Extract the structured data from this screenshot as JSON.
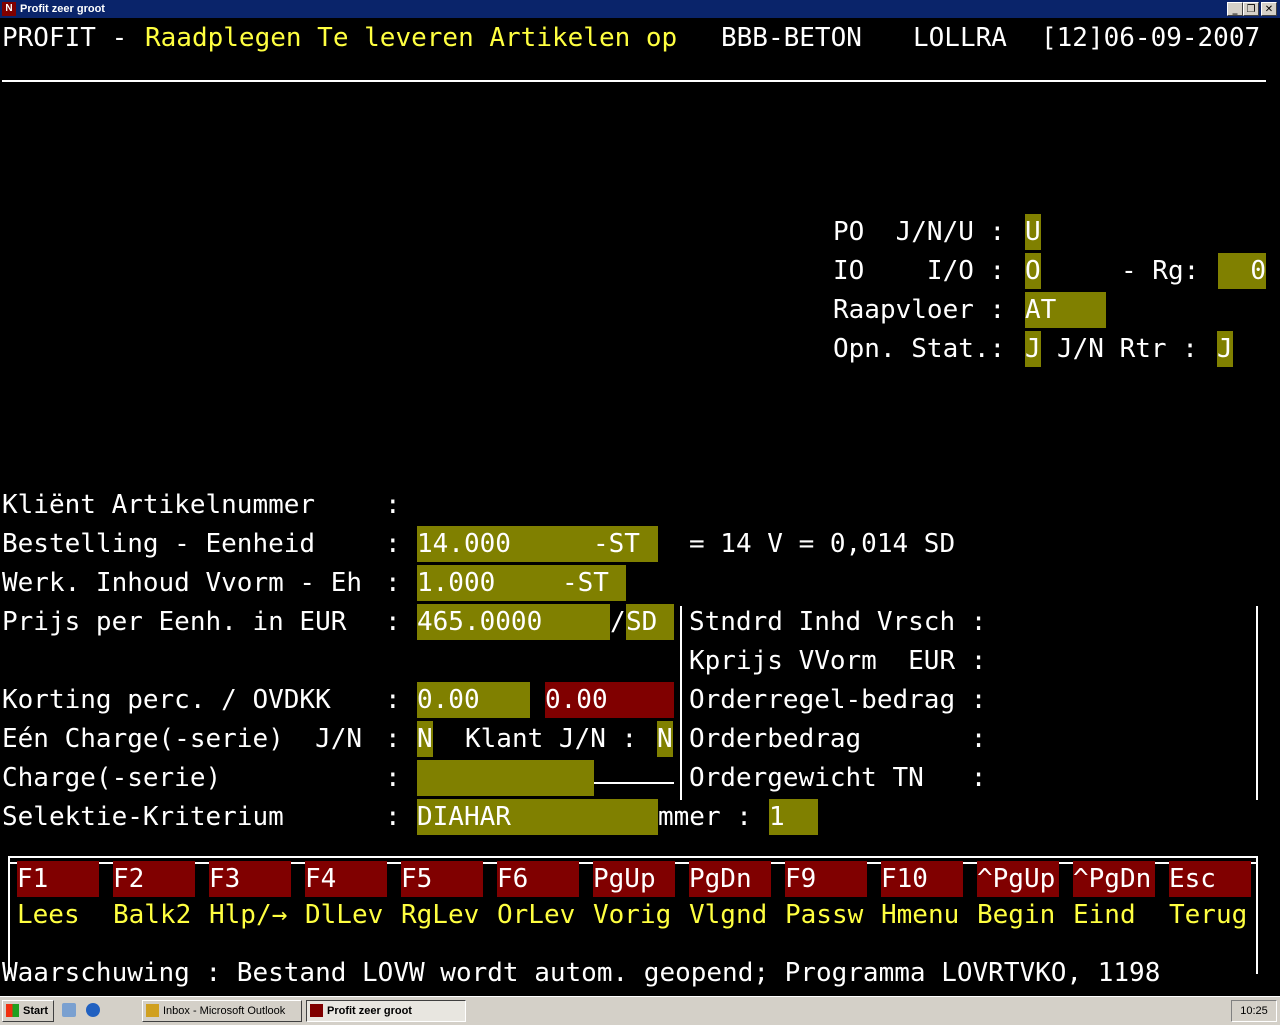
{
  "window": {
    "title": "Profit zeer groot",
    "icon_letter": "N",
    "min_glyph": "_",
    "max_glyph": "❐",
    "close_glyph": "✕"
  },
  "header": {
    "app": "PROFIT -",
    "title": "Raadplegen Te leveren Artikelen op",
    "company": "BBB-BETON",
    "user": "LOLLRA",
    "date": "[12]06-09-2007"
  },
  "options": {
    "po_label": "PO  J/N/U :",
    "po_value": "U",
    "io_label": "IO    I/O :",
    "io_value": "O",
    "rg_label": "- Rg:",
    "rg_value": "0",
    "raapvloer_label": "Raapvloer :",
    "raapvloer_value": "AT",
    "opn_label": "Opn. Stat.:",
    "opn_value": "J",
    "rtr_label": "J/N Rtr :",
    "rtr_value": "J"
  },
  "form": {
    "klient_label": "Kliënt Artikelnummer",
    "bestelling_label": "Bestelling - Eenheid",
    "bestelling_value": "14.000",
    "bestelling_unit": "-ST",
    "bestelling_info": "= 14 V = 0,014 SD",
    "werk_label": "Werk. Inhoud Vvorm - Eh",
    "werk_value": "1.000",
    "werk_unit": "-ST",
    "prijs_label": "Prijs per Eenh. in EUR",
    "prijs_value": "465.0000",
    "prijs_sep": "/",
    "prijs_unit": "SD",
    "korting_label": "Korting perc. / OVDKK",
    "korting_value": "0.00",
    "ovdkk_value": "0.00",
    "charge_label": "Eén Charge(-serie)  J/N",
    "charge_value": "N",
    "klant_label": "Klant J/N :",
    "klant_value": "N",
    "charge_serie_label": "Charge(-serie)",
    "selectie_label": "Selektie-Kriterium",
    "selectie_value": "DIAHAR",
    "nummer_label": "mmer :",
    "nummer_value": "1",
    "colon": ":"
  },
  "right_panel": {
    "stndrd": "Stndrd Inhd Vrsch :",
    "kprijs": "Kprijs VVorm  EUR :",
    "orderregel": "Orderregel-bedrag :",
    "orderbedrag": "Orderbedrag       :",
    "ordergewicht": "Ordergewicht TN   :"
  },
  "function_keys": [
    {
      "key": "F1",
      "label": "Lees"
    },
    {
      "key": "F2",
      "label": "Balk2"
    },
    {
      "key": "F3",
      "label": "Hlp/→"
    },
    {
      "key": "F4",
      "label": "DlLev"
    },
    {
      "key": "F5",
      "label": "RgLev"
    },
    {
      "key": "F6",
      "label": "OrLev"
    },
    {
      "key": "PgUp",
      "label": "Vorig"
    },
    {
      "key": "PgDn",
      "label": "Vlgnd"
    },
    {
      "key": "F9",
      "label": "Passw"
    },
    {
      "key": "F10",
      "label": "Hmenu"
    },
    {
      "key": "^PgUp",
      "label": "Begin"
    },
    {
      "key": "^PgDn",
      "label": "Eind"
    },
    {
      "key": "Esc",
      "label": "Terug"
    }
  ],
  "status_message": "Waarschuwing : Bestand LOVW wordt autom. geopend; Programma LOVRTVKO, 1198",
  "taskbar": {
    "start": "Start",
    "tasks": [
      "Inbox - Microsoft Outlook",
      "Profit zeer groot"
    ],
    "time": "10:25"
  },
  "colors": {
    "field": "#808000",
    "highlight": "#800000",
    "title_text": "#ffff40"
  }
}
